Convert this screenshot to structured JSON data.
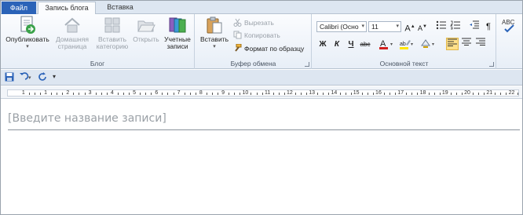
{
  "tabs": {
    "file": "Файл",
    "blog_post": "Запись блога",
    "insert": "Вставка"
  },
  "groups": {
    "blog": {
      "label": "Блог",
      "publish": "Опубликовать",
      "home_page_l1": "Домашняя",
      "home_page_l2": "страница",
      "insert_category_l1": "Вставить",
      "insert_category_l2": "категорию",
      "open": "Открыть",
      "accounts_l1": "Учетные",
      "accounts_l2": "записи"
    },
    "clipboard": {
      "label": "Буфер обмена",
      "paste": "Вставить",
      "cut": "Вырезать",
      "copy": "Копировать",
      "format_painter": "Формат по образцу"
    },
    "basic_text": {
      "label": "Основной текст",
      "font_name": "Calibri (Осно",
      "font_size": "11"
    }
  },
  "document": {
    "title_placeholder": "[Введите название записи]"
  },
  "ruler": {
    "numbers": [
      "1",
      "1",
      "2",
      "3",
      "4",
      "5",
      "6",
      "7",
      "8",
      "9",
      "10",
      "11",
      "12",
      "13",
      "14",
      "15",
      "16",
      "17",
      "18",
      "19",
      "20",
      "21",
      "22"
    ]
  },
  "icons": [
    "publish-icon",
    "home-icon",
    "category-icon",
    "open-folder-icon",
    "accounts-icon",
    "paste-icon",
    "scissors-icon",
    "copy-icon",
    "brush-icon",
    "bold-icon",
    "italic-icon",
    "underline-icon",
    "strikethrough-icon",
    "font-color-icon",
    "highlight-icon",
    "styles-icon",
    "save-icon",
    "undo-icon",
    "refresh-icon"
  ],
  "colors": {
    "file_tab": "#2b63b8",
    "font_color": "#d0201e",
    "highlight": "#ffe600"
  }
}
